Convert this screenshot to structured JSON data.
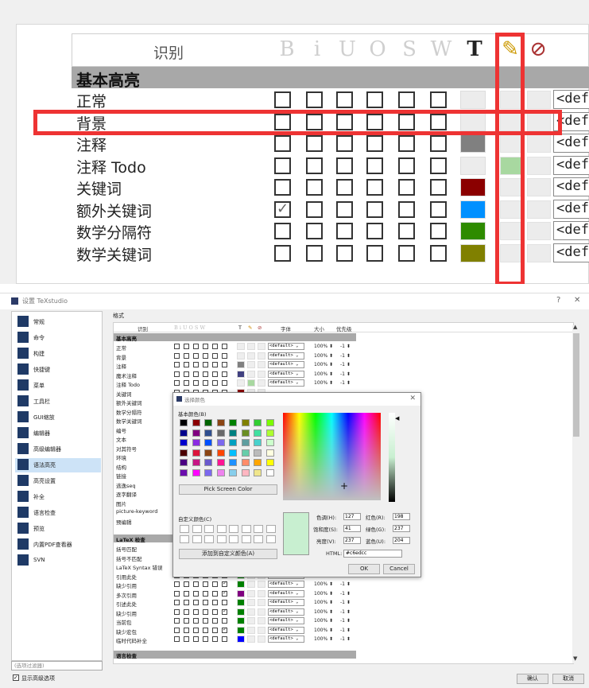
{
  "zoom": {
    "header": {
      "label": "识别",
      "icons": [
        "B",
        "i",
        "U",
        "O",
        "S",
        "W",
        "T",
        "paint-icon",
        "no-color-icon"
      ]
    },
    "section": "基本高亮",
    "rows": [
      {
        "name": "正常",
        "checks": [
          false,
          false,
          false,
          false,
          false,
          false
        ],
        "fg": "#ececec",
        "bg": "#ececec",
        "font": "<def"
      },
      {
        "name": "背景",
        "checks": [
          false,
          false,
          false,
          false,
          false,
          false
        ],
        "fg": "#ececec",
        "bg": "#ececec",
        "font": "<def"
      },
      {
        "name": "注释",
        "checks": [
          false,
          false,
          false,
          false,
          false,
          false
        ],
        "fg": "#808080",
        "bg": "#ececec",
        "font": "<def"
      },
      {
        "name": "注释 Todo",
        "checks": [
          false,
          false,
          false,
          false,
          false,
          false
        ],
        "fg": "#ececec",
        "bg": "#a8d8a0",
        "font": "<def"
      },
      {
        "name": "关键词",
        "checks": [
          false,
          false,
          false,
          false,
          false,
          false
        ],
        "fg": "#8b0000",
        "bg": "#ececec",
        "font": "<def"
      },
      {
        "name": "额外关键词",
        "checks": [
          true,
          false,
          false,
          false,
          false,
          false
        ],
        "fg": "#0090ff",
        "bg": "#ececec",
        "font": "<def"
      },
      {
        "name": "数学分隔符",
        "checks": [
          false,
          false,
          false,
          false,
          false,
          false
        ],
        "fg": "#2e8b00",
        "bg": "#ececec",
        "font": "<def"
      },
      {
        "name": "数学关键词",
        "checks": [
          false,
          false,
          false,
          false,
          false,
          false
        ],
        "fg": "#808000",
        "bg": "#ececec",
        "font": "<def"
      }
    ]
  },
  "window": {
    "title": "设置 TeXstudio",
    "help": "?",
    "close": "✕",
    "sidebar": [
      "常规",
      "命令",
      "构建",
      "快捷键",
      "菜单",
      "工具栏",
      "GUI缩放",
      "编辑器",
      "高级编辑器",
      "语法高亮",
      "高亮设置",
      "补全",
      "语言检查",
      "预览",
      "内置PDF查看器",
      "SVN"
    ],
    "selected": "语法高亮",
    "filter_placeholder": "(选项过滤器)",
    "show_advanced": "显示高级选项",
    "ok": "确认",
    "cancel": "取消",
    "format_label": "格式",
    "columns": {
      "name": "识别",
      "font": "字体",
      "size": "大小",
      "priority": "优先级"
    },
    "section1": "基本高亮",
    "rows1": [
      {
        "name": "正常",
        "fg": "#eeeeee",
        "bg": "#eeeeee",
        "font": "<default>",
        "size": "100%",
        "pr": "-1",
        "on": false
      },
      {
        "name": "背景",
        "fg": "#eeeeee",
        "bg": "#eeeeee",
        "font": "<default>",
        "size": "100%",
        "pr": "-1",
        "on": false
      },
      {
        "name": "注释",
        "fg": "#808080",
        "bg": "#eeeeee",
        "font": "<default>",
        "size": "100%",
        "pr": "-1",
        "on": false
      },
      {
        "name": "魔术注释",
        "fg": "#404080",
        "bg": "#eeeeee",
        "font": "<default>",
        "size": "100%",
        "pr": "-1",
        "on": false
      },
      {
        "name": "注释 Todo",
        "fg": "#eeeeee",
        "bg": "#a8d8a0",
        "font": "<default>",
        "size": "100%",
        "pr": "-1",
        "on": false
      },
      {
        "name": "关键词",
        "fg": "#8b0000",
        "bg": "#eeeeee",
        "font": "",
        "size": "",
        "pr": "",
        "on": false
      },
      {
        "name": "额外关键词",
        "fg": "",
        "bg": "",
        "font": "",
        "size": "",
        "pr": "",
        "on": false
      },
      {
        "name": "数学分隔符",
        "fg": "",
        "bg": "",
        "font": "",
        "size": "",
        "pr": "",
        "on": false
      },
      {
        "name": "数学关键词",
        "fg": "",
        "bg": "",
        "font": "",
        "size": "",
        "pr": "",
        "on": false
      },
      {
        "name": "编号",
        "fg": "",
        "bg": "",
        "font": "",
        "size": "",
        "pr": "",
        "on": false
      },
      {
        "name": "文本",
        "fg": "",
        "bg": "",
        "font": "",
        "size": "",
        "pr": "",
        "on": false
      },
      {
        "name": "对其符号",
        "fg": "",
        "bg": "",
        "font": "",
        "size": "",
        "pr": "",
        "on": false
      },
      {
        "name": "环境",
        "fg": "",
        "bg": "",
        "font": "",
        "size": "",
        "pr": "",
        "on": false
      },
      {
        "name": "结构",
        "fg": "",
        "bg": "",
        "font": "",
        "size": "",
        "pr": "",
        "on": false
      },
      {
        "name": "链接",
        "fg": "",
        "bg": "",
        "font": "",
        "size": "",
        "pr": "",
        "on": false
      },
      {
        "name": "逃逸seq",
        "fg": "",
        "bg": "",
        "font": "",
        "size": "",
        "pr": "",
        "on": false
      },
      {
        "name": "逐字翻译",
        "fg": "",
        "bg": "",
        "font": "",
        "size": "",
        "pr": "",
        "on": false
      },
      {
        "name": "图片",
        "fg": "",
        "bg": "",
        "font": "",
        "size": "",
        "pr": "",
        "on": false
      },
      {
        "name": "picture-keyword",
        "fg": "",
        "bg": "",
        "font": "",
        "size": "",
        "pr": "",
        "on": false
      },
      {
        "name": "预编辑",
        "fg": "",
        "bg": "",
        "font": "",
        "size": "",
        "pr": "",
        "on": false
      }
    ],
    "section2": "LaTeX 检查",
    "rows2": [
      {
        "name": "括号匹配",
        "fg": "",
        "bg": "",
        "font": "",
        "size": "",
        "pr": "",
        "on": false
      },
      {
        "name": "括号不匹配",
        "fg": "",
        "bg": "",
        "font": "",
        "size": "",
        "pr": "",
        "on": false
      },
      {
        "name": "LaTeX Syntax 错误",
        "fg": "",
        "bg": "",
        "font": "",
        "size": "",
        "pr": "",
        "on": false
      },
      {
        "name": "引用此处",
        "fg": "#008000",
        "bg": "#eeeeee",
        "font": "<default>",
        "size": "100%",
        "pr": "-1",
        "on": false
      },
      {
        "name": "缺少引用",
        "fg": "#008000",
        "bg": "#eeeeee",
        "font": "<default>",
        "size": "100%",
        "pr": "-1",
        "on": true
      },
      {
        "name": "多次引用",
        "fg": "#800080",
        "bg": "#eeeeee",
        "font": "<default>",
        "size": "100%",
        "pr": "-1",
        "on": true
      },
      {
        "name": "引述此处",
        "fg": "#008000",
        "bg": "#eeeeee",
        "font": "<default>",
        "size": "100%",
        "pr": "-1",
        "on": false
      },
      {
        "name": "缺少引用",
        "fg": "#008000",
        "bg": "#eeeeee",
        "font": "<default>",
        "size": "100%",
        "pr": "-1",
        "on": true
      },
      {
        "name": "当前包",
        "fg": "#008000",
        "bg": "#eeeeee",
        "font": "<default>",
        "size": "100%",
        "pr": "-1",
        "on": false
      },
      {
        "name": "缺少宏包",
        "fg": "#008000",
        "bg": "#eeeeee",
        "font": "<default>",
        "size": "100%",
        "pr": "-1",
        "on": true
      },
      {
        "name": "临时代码补全",
        "fg": "#0000ff",
        "bg": "#eeeeee",
        "font": "<default>",
        "size": "100%",
        "pr": "-1",
        "on": false
      }
    ],
    "section3": "语言检查"
  },
  "color_dialog": {
    "title": "选择颜色",
    "close": "✕",
    "basic_label": "基本颜色(B)",
    "pick_screen": "Pick Screen Color",
    "custom_label": "自定义颜色(C)",
    "add_custom": "添加到自定义颜色(A)",
    "basic_colors": [
      "#000000",
      "#8b0000",
      "#006400",
      "#8b4513",
      "#008000",
      "#808000",
      "#32cd32",
      "#7cfc00",
      "#00008b",
      "#800080",
      "#2f4f8f",
      "#696969",
      "#008080",
      "#6b8e23",
      "#40e0a0",
      "#adff2f",
      "#0000cd",
      "#8a2be2",
      "#0050ff",
      "#7b68ee",
      "#00a0c0",
      "#5f9ea0",
      "#48d1cc",
      "#ccffcc",
      "#4b0000",
      "#dc143c",
      "#8b4513",
      "#ff4500",
      "#00bfff",
      "#66cdaa",
      "#bbbbbb",
      "#ffffe0",
      "#4b0082",
      "#c71585",
      "#6a5acd",
      "#ff1493",
      "#1e90ff",
      "#ff8c69",
      "#ffa500",
      "#ffff00",
      "#6a0dad",
      "#ff00ff",
      "#7b68ee",
      "#ee82ee",
      "#87ceeb",
      "#ffb6c1",
      "#f0e68c",
      "#ffffff"
    ],
    "hue_label": "色调(H):",
    "hue": "127",
    "sat_label": "饱和度(S):",
    "sat": "41",
    "val_label": "亮度(V):",
    "val": "237",
    "red_label": "红色(R):",
    "red": "198",
    "green_label": "绿色(G):",
    "green": "237",
    "blue_label": "蓝色(U):",
    "blue": "204",
    "html_label": "HTML:",
    "html": "#c6edcc",
    "ok": "OK",
    "cancel": "Cancel"
  }
}
